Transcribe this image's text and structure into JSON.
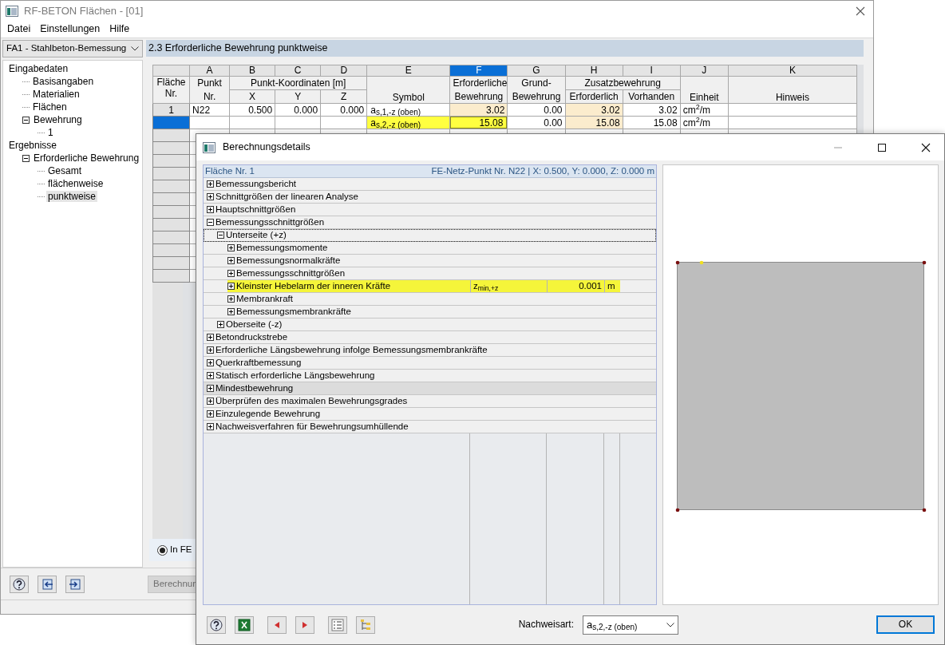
{
  "main_window": {
    "title": "RF-BETON Flächen - [01]",
    "menu": [
      "Datei",
      "Einstellungen",
      "Hilfe"
    ],
    "case_selector": {
      "value": "FA1 - Stahlbeton-Bemessung"
    },
    "navigator": [
      {
        "label": "Eingabedaten",
        "selected": false,
        "children": [
          {
            "label": "Basisangaben",
            "selected": false
          },
          {
            "label": "Materialien",
            "selected": false
          },
          {
            "label": "Flächen",
            "selected": false
          },
          {
            "label": "Bewehrung",
            "selected": false,
            "expanded": true,
            "children": [
              {
                "label": "1",
                "selected": false
              }
            ]
          }
        ]
      },
      {
        "label": "Ergebnisse",
        "selected": false,
        "children": [
          {
            "label": "Erforderliche Bewehrung",
            "selected": false,
            "expanded": true,
            "children": [
              {
                "label": "Gesamt",
                "selected": false
              },
              {
                "label": "flächenweise",
                "selected": false
              },
              {
                "label": "punktweise",
                "selected": true
              }
            ]
          }
        ]
      }
    ],
    "section_title": "2.3 Erforderliche Bewehrung punktweise",
    "table": {
      "corner": "Fläche Nr.",
      "groups": [
        {
          "title": "Punkt",
          "columns": [
            {
              "letter": "A",
              "label": "Nr.",
              "selected": false,
              "shaded": false
            }
          ]
        },
        {
          "title": "Punkt-Koordinaten [m]",
          "columns": [
            {
              "letter": "B",
              "label": "X",
              "selected": false,
              "shaded": false
            },
            {
              "letter": "C",
              "label": "Y",
              "selected": false,
              "shaded": false
            },
            {
              "letter": "D",
              "label": "Z",
              "selected": false,
              "shaded": false
            }
          ]
        },
        {
          "columns": [
            {
              "letter": "E",
              "label": "Symbol",
              "selected": false,
              "shaded": false
            }
          ]
        },
        {
          "title": "Erforderliche",
          "columns": [
            {
              "letter": "F",
              "label": "Bewehrung",
              "selected": true,
              "shaded": true
            }
          ]
        },
        {
          "title": "Grund-",
          "columns": [
            {
              "letter": "G",
              "label": "Bewehrung",
              "selected": false,
              "shaded": false
            }
          ]
        },
        {
          "title": "Zusatzbewehrung",
          "columns": [
            {
              "letter": "H",
              "label": "Erforderlich",
              "selected": false,
              "shaded": true
            },
            {
              "letter": "I",
              "label": "Vorhanden",
              "selected": false,
              "shaded": false
            }
          ]
        },
        {
          "columns": [
            {
              "letter": "J",
              "label": "Einheit",
              "selected": false,
              "shaded": false
            }
          ]
        },
        {
          "columns": [
            {
              "letter": "K",
              "label": "Hinweis",
              "selected": false,
              "shaded": false
            }
          ]
        }
      ],
      "rows": [
        {
          "header": "1",
          "selected": false,
          "cells": {
            "A": {
              "text": "N22",
              "highlighted": false
            },
            "B": {
              "text": "0.500",
              "highlighted": false
            },
            "C": {
              "text": "0.000",
              "highlighted": false
            },
            "D": {
              "text": "0.000",
              "highlighted": false
            },
            "E": {
              "text": "a$_{s,1,-z (oben)}$",
              "highlighted": false
            },
            "F": {
              "text": "3.02",
              "highlighted": false
            },
            "G": {
              "text": "0.00",
              "highlighted": false
            },
            "H": {
              "text": "3.02",
              "highlighted": false
            },
            "I": {
              "text": "3.02",
              "highlighted": false
            },
            "J": {
              "text": "cm$^{2}$/m",
              "highlighted": false
            }
          }
        },
        {
          "selected": true,
          "cells": {
            "E": {
              "text": "a$_{s,2,-z (oben)}$",
              "highlighted": true
            },
            "F": {
              "text": "15.08",
              "highlighted": true
            },
            "G": {
              "text": "0.00",
              "highlighted": false
            },
            "H": {
              "text": "15.08",
              "highlighted": false
            },
            "I": {
              "text": "15.08",
              "highlighted": false
            },
            "J": {
              "text": "cm$^{2}$/m",
              "highlighted": false
            }
          }
        }
      ]
    },
    "radio": {
      "label": "In FE",
      "selected": true
    },
    "calc_button": "Berechnun"
  },
  "dialog": {
    "title": "Berechnungsdetails",
    "header_left": "Fläche Nr. 1",
    "header_right": "FE-Netz-Punkt Nr. N22  |  X: 0.500, Y: 0.000, Z: 0.000 m",
    "items": [
      {
        "label": "Bemessungsbericht",
        "expanded": false,
        "selected": false,
        "focused": false
      },
      {
        "label": "Schnittgrößen der linearen Analyse",
        "expanded": false,
        "selected": false,
        "focused": false
      },
      {
        "label": "Hauptschnittgrößen",
        "expanded": false,
        "selected": false,
        "focused": false
      },
      {
        "label": "Bemessungsschnittgrößen",
        "expanded": true,
        "selected": false,
        "focused": false,
        "children": [
          {
            "label": "Unterseite (+z)",
            "expanded": true,
            "selected": false,
            "focused": true,
            "children": [
              {
                "label": "Bemessungsmomente",
                "expanded": false,
                "selected": false,
                "focused": false
              },
              {
                "label": "Bemessungsnormalkräfte",
                "expanded": false,
                "selected": false,
                "focused": false
              },
              {
                "label": "Bemessungsschnittgrößen",
                "expanded": false,
                "selected": false,
                "focused": false
              },
              {
                "kind": "result",
                "label": "Kleinster Hebelarm der inneren Kräfte",
                "symbol": "z$_{min,+z}$",
                "value": "0.001",
                "unit": "m",
                "expanded": false,
                "selected": false,
                "focused": false
              },
              {
                "label": "Membrankraft",
                "expanded": false,
                "selected": false,
                "focused": false
              },
              {
                "label": "Bemessungsmembrankräfte",
                "expanded": false,
                "selected": false,
                "focused": false
              }
            ]
          },
          {
            "label": "Oberseite (-z)",
            "expanded": false,
            "selected": false,
            "focused": false
          }
        ]
      },
      {
        "label": "Betondruckstrebe",
        "expanded": false,
        "selected": false,
        "focused": false
      },
      {
        "label": "Erforderliche Längsbewehrung infolge Bemessungsmembrankräfte",
        "expanded": false,
        "selected": false,
        "focused": false
      },
      {
        "label": "Querkraftbemessung",
        "expanded": false,
        "selected": false,
        "focused": false
      },
      {
        "label": "Statisch erforderliche Längsbewehrung",
        "expanded": false,
        "selected": false,
        "focused": false
      },
      {
        "label": "Mindestbewehrung",
        "expanded": false,
        "selected": true,
        "focused": false
      },
      {
        "label": "Überprüfen des maximalen Bewehrungsgrades",
        "expanded": false,
        "selected": false,
        "focused": false
      },
      {
        "label": "Einzulegende Bewehrung",
        "expanded": false,
        "selected": false,
        "focused": false
      },
      {
        "label": "Nachweisverfahren für Bewehrungsumhüllende",
        "expanded": false,
        "selected": false,
        "focused": false
      }
    ],
    "check_type": {
      "label": "Nachweisart:",
      "value": "a$_{s,2,-z (oben)}$"
    },
    "ok_button": "OK"
  }
}
